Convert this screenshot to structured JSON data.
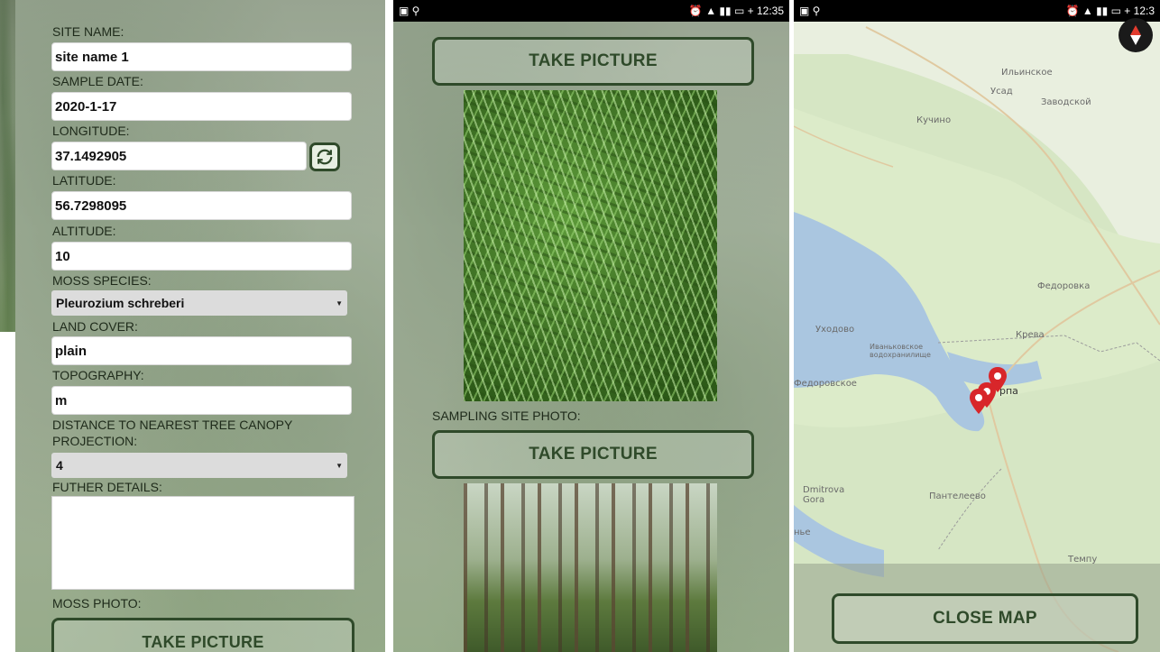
{
  "form": {
    "site_name_label": "SITE NAME:",
    "site_name_value": "site name 1",
    "sample_date_label": "SAMPLE DATE:",
    "sample_date_value": "2020-1-17",
    "longitude_label": "LONGITUDE:",
    "longitude_value": "37.1492905",
    "latitude_label": "LATITUDE:",
    "latitude_value": "56.7298095",
    "altitude_label": "ALTITUDE:",
    "altitude_value": "10",
    "moss_species_label": "MOSS SPECIES:",
    "moss_species_value": "Pleurozium schreberi",
    "land_cover_label": "LAND COVER:",
    "land_cover_value": "plain",
    "topography_label": "TOPOGRAPHY:",
    "topography_value": "m",
    "distance_label_line1": "DISTANCE TO NEAREST TREE CANOPY",
    "distance_label_line2": "PROJECTION:",
    "distance_value": "4",
    "further_details_label": "FUTHER DETAILS:",
    "further_details_value": "",
    "moss_photo_label": "MOSS PHOTO:",
    "take_picture_label": "TAKE PICTURE",
    "refresh_icon": "refresh-icon"
  },
  "photos": {
    "status_time": "12:35",
    "take_picture_top": "TAKE PICTURE",
    "sampling_site_label": "SAMPLING SITE PHOTO:",
    "take_picture_bottom": "TAKE PICTURE"
  },
  "map": {
    "status_time": "12:3",
    "places": [
      "Ильинское",
      "Усад",
      "Заводской",
      "Кучино",
      "Федоровка",
      "Уходово",
      "Иваньковское водохранилище",
      "Федоровское",
      "Крева",
      "рпа",
      "Dmitrova Gora",
      "Пантелеево",
      "нье",
      "Темпу"
    ],
    "close_map_label": "CLOSE MAP",
    "compass_icon": "compass-icon",
    "marker_icon": "map-marker-icon"
  },
  "colors": {
    "button_border": "#2f4a2a",
    "marker": "#d8262a"
  }
}
